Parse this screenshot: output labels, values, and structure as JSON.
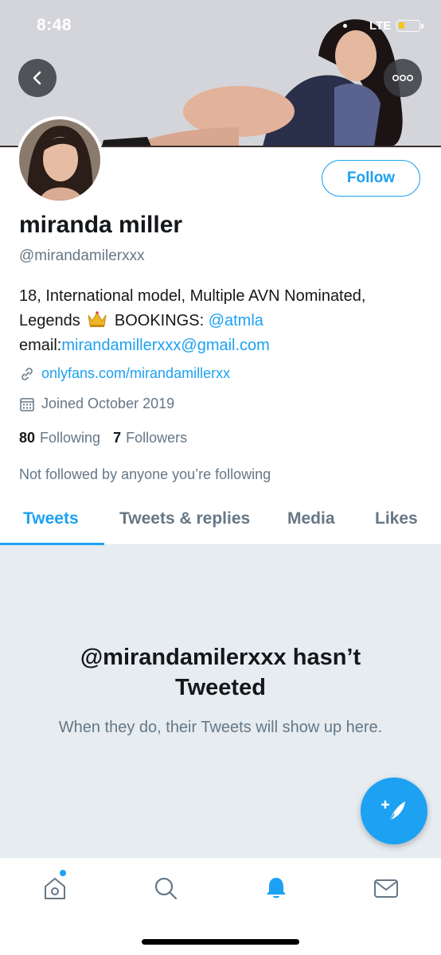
{
  "status_bar": {
    "time": "8:48",
    "network": "LTE",
    "battery_level": 0.3,
    "battery_color": "#f5c518"
  },
  "header": {
    "back_icon": "chevron-left-icon",
    "more_icon": "more-icon"
  },
  "profile": {
    "follow_label": "Follow",
    "name": "miranda miller",
    "handle": "@mirandamilerxxx",
    "bio": {
      "line1": "18, International model, Multiple AVN Nominated,",
      "legends_text": "Legends",
      "bookings_text": "BOOKINGS:",
      "bookings_link": "@atmla",
      "email_label": "email:",
      "email_link": "mirandamillerxxx@gmail.com"
    },
    "website": "onlyfans.com/mirandamillerxx",
    "joined": "Joined October 2019",
    "following_count": "80",
    "following_label": "Following",
    "followers_count": "7",
    "followers_label": "Followers",
    "not_followed_text": "Not followed by anyone you’re following"
  },
  "tabs": [
    {
      "label": "Tweets",
      "active": true
    },
    {
      "label": "Tweets & replies",
      "active": false
    },
    {
      "label": "Media",
      "active": false
    },
    {
      "label": "Likes",
      "active": false
    }
  ],
  "empty_state": {
    "title": "@mirandamilerxxx hasn’t Tweeted",
    "subtitle": "When they do, their Tweets will show up here."
  },
  "bottom_nav": [
    {
      "icon": "home-icon",
      "active": false,
      "notification_dot": true
    },
    {
      "icon": "search-icon",
      "active": false
    },
    {
      "icon": "notifications-bell-icon",
      "active": true
    },
    {
      "icon": "messages-envelope-icon",
      "active": false
    }
  ],
  "colors": {
    "accent": "#1da1f2",
    "secondary_text": "#657786",
    "primary_text": "#14171a",
    "empty_bg": "#e6ecf0"
  }
}
